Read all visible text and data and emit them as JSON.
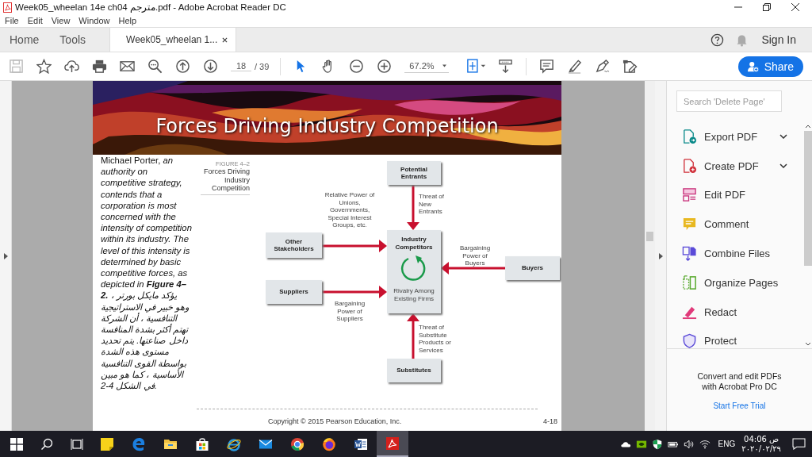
{
  "window": {
    "title": "Week05_wheelan 14e ch04 مترجم.pdf - Adobe Acrobat Reader DC"
  },
  "menu": [
    "File",
    "Edit",
    "View",
    "Window",
    "Help"
  ],
  "tabs": [
    {
      "label": "Home",
      "selected": false,
      "closable": false
    },
    {
      "label": "Tools",
      "selected": false,
      "closable": false
    },
    {
      "label": "Week05_wheelan 1...",
      "selected": true,
      "closable": true
    }
  ],
  "header": {
    "sign_in": "Sign In"
  },
  "toolbar": {
    "page_current": "18",
    "page_total": "/ 39",
    "zoom": "67.2%",
    "share": "Share",
    "tools": [
      {
        "kind": "select",
        "selected": true
      },
      {
        "kind": "hand",
        "selected": false
      }
    ]
  },
  "document": {
    "banner_title": "Forces Driving Industry Competition",
    "body_text": "Michael Porter, *an authority on competitive strategy, contends that a corporation is most concerned with the intensity of competition within its industry. The level of this intensity is determined by basic competitive forces, as depicted in* **Figure 4–2.** *يؤكد مايكل بورتر ، وهو خبير في الاستراتيجية التنافسية ، أن الشركة تهتم أكثر بشدة المنافسة داخل صناعتها. يتم تحديد مستوى هذه الشدة بواسطة القوى التنافسية الأساسية ، كما هو مبين في الشكل 4-2.*",
    "figure": {
      "label": "FIGURE 4–2",
      "caption": "Forces Driving Industry Competition",
      "nodes": [
        {
          "label": "Potential Entrants"
        },
        {
          "label": "Other Stakeholders"
        },
        {
          "label": "Suppliers"
        },
        {
          "label": "Buyers"
        },
        {
          "label": "Substitutes"
        }
      ],
      "center": {
        "title": "Industry Competitors",
        "subtitle": "Rivalry Among Existing Firms"
      },
      "forces": [
        {
          "label": "Relative Power of Unions, Governments, Special Interest Groups, etc."
        },
        {
          "label": "Threat of New Entrants"
        },
        {
          "label": "Bargaining Power of Buyers"
        },
        {
          "label": "Bargaining Power of Suppliers"
        },
        {
          "label": "Threat of Substitute Products or Services"
        }
      ]
    },
    "copyright": "Copyright © 2015 Pearson Education, Inc.",
    "page_number": "4-18"
  },
  "right_panel": {
    "search_placeholder": "Search 'Delete Page'",
    "tools": [
      {
        "kind": "export",
        "label": "Export PDF",
        "expandable": true
      },
      {
        "kind": "create",
        "label": "Create PDF",
        "expandable": true
      },
      {
        "kind": "edit",
        "label": "Edit PDF",
        "expandable": false
      },
      {
        "kind": "comment",
        "label": "Comment",
        "expandable": false
      },
      {
        "kind": "combine",
        "label": "Combine Files",
        "expandable": false
      },
      {
        "kind": "organize",
        "label": "Organize Pages",
        "expandable": false
      },
      {
        "kind": "redact",
        "label": "Redact",
        "expandable": false
      },
      {
        "kind": "protect",
        "label": "Protect",
        "expandable": false
      }
    ],
    "promo": "Convert and edit PDFs with Acrobat Pro DC",
    "trial_link": "Start Free Trial"
  },
  "taskbar": {
    "apps": [
      {
        "kind": "sticky",
        "selected": false
      },
      {
        "kind": "edge",
        "selected": false
      },
      {
        "kind": "explorer",
        "selected": false
      },
      {
        "kind": "store",
        "selected": false
      },
      {
        "kind": "ie",
        "selected": false
      },
      {
        "kind": "mail",
        "selected": false
      },
      {
        "kind": "chrome",
        "selected": false
      },
      {
        "kind": "firefox",
        "selected": false
      },
      {
        "kind": "word",
        "selected": false
      },
      {
        "kind": "acrobat",
        "selected": true
      }
    ],
    "language": "ENG",
    "time": "04:06",
    "period": "ص",
    "date": "٢٠٢٠/٠٢/٢٩"
  }
}
